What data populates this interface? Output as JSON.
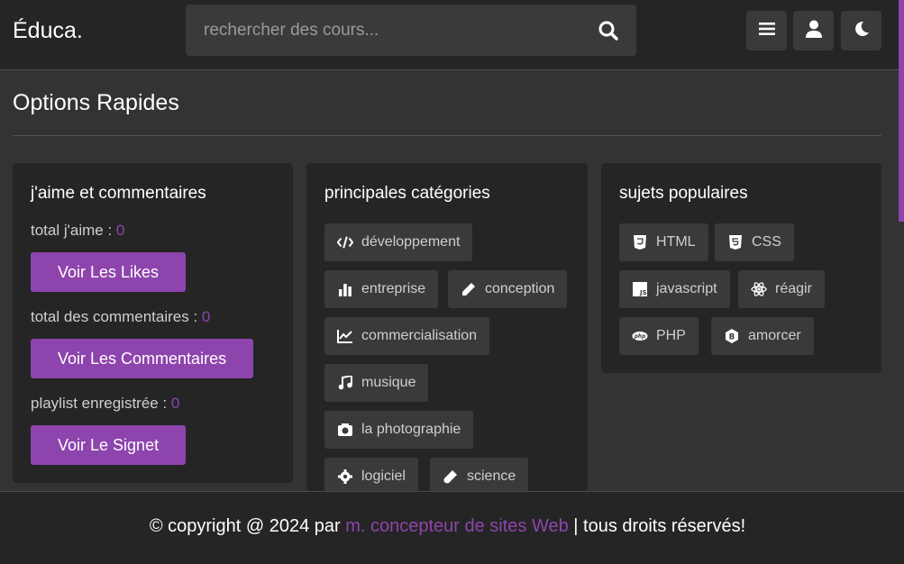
{
  "header": {
    "logo": "Éduca.",
    "search_placeholder": "rechercher des cours...",
    "buttons": [
      {
        "name": "menu-icon"
      },
      {
        "name": "user-icon"
      },
      {
        "name": "moon-icon"
      }
    ]
  },
  "main": {
    "title": "Options Rapides",
    "likes_card": {
      "title": "j'aime et commentaires",
      "likes_label": "total j'aime : ",
      "likes_value": "0",
      "likes_button": "Voir Les Likes",
      "comments_label": "total des commentaires : ",
      "comments_value": "0",
      "comments_button": "Voir Les Commentaires",
      "playlist_label": "playlist enregistrée : ",
      "playlist_value": "0",
      "playlist_button": "Voir Le Signet"
    },
    "categories_card": {
      "title": "principales catégories",
      "items": [
        {
          "label": "développement",
          "icon": "code-icon"
        },
        {
          "label": "entreprise",
          "icon": "bar-chart-icon"
        },
        {
          "label": "conception",
          "icon": "pen-icon"
        },
        {
          "label": "commercialisation",
          "icon": "line-chart-icon"
        },
        {
          "label": "musique",
          "icon": "music-icon"
        },
        {
          "label": "la photographie",
          "icon": "camera-icon"
        },
        {
          "label": "logiciel",
          "icon": "gear-icon"
        },
        {
          "label": "science",
          "icon": "vial-icon"
        }
      ]
    },
    "topics_card": {
      "title": "sujets populaires",
      "items": [
        {
          "label": "HTML",
          "icon": "html5-icon"
        },
        {
          "label": "CSS",
          "icon": "css3-icon"
        },
        {
          "label": "javascript",
          "icon": "js-icon"
        },
        {
          "label": "réagir",
          "icon": "react-icon"
        },
        {
          "label": "PHP",
          "icon": "php-icon"
        },
        {
          "label": "amorcer",
          "icon": "bootstrap-icon"
        }
      ]
    }
  },
  "footer": {
    "prefix": "© copyright @ 2024 par ",
    "link": "m. concepteur de sites Web",
    "suffix": " | tous droits réservés!"
  },
  "colors": {
    "accent": "#8e44ad",
    "card": "#252525",
    "tag": "#3a3a3a",
    "background": "#333333"
  }
}
